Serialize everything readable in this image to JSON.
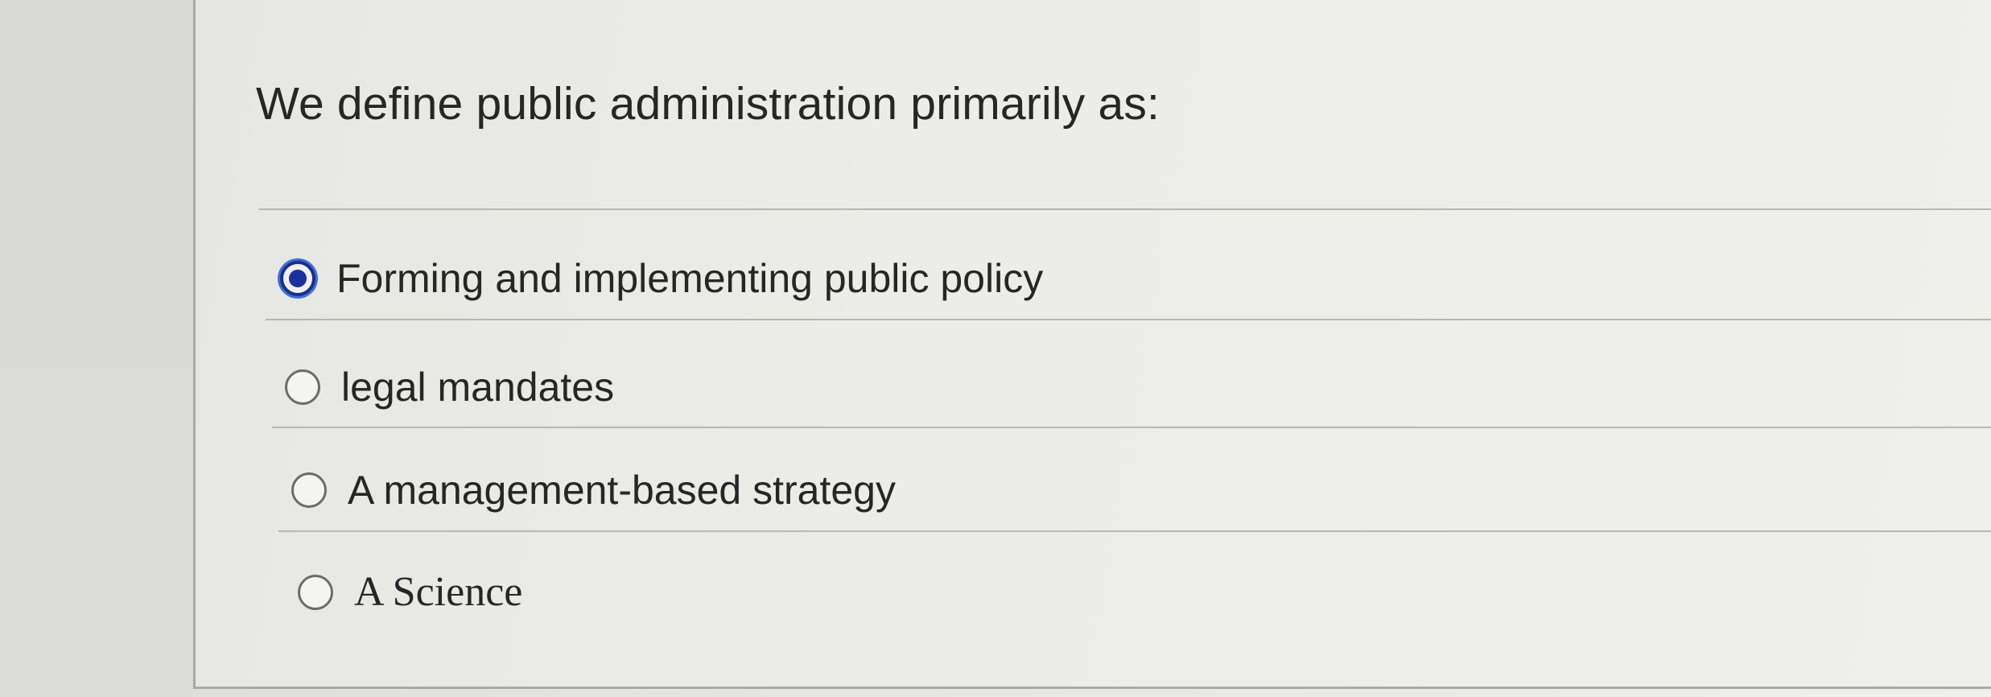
{
  "question": {
    "text": "We define public administration primarily as:"
  },
  "options": [
    {
      "label": "Forming and implementing public policy",
      "selected": true
    },
    {
      "label": "legal mandates",
      "selected": false
    },
    {
      "label": "A management-based strategy",
      "selected": false
    },
    {
      "label": "A Science",
      "selected": false
    }
  ],
  "colors": {
    "selected_radio": "#1b2fa0",
    "text": "#262626",
    "background": "#e8e8e4"
  },
  "icons": {
    "selected": "radio-selected-icon",
    "unselected": "radio-unselected-icon"
  }
}
